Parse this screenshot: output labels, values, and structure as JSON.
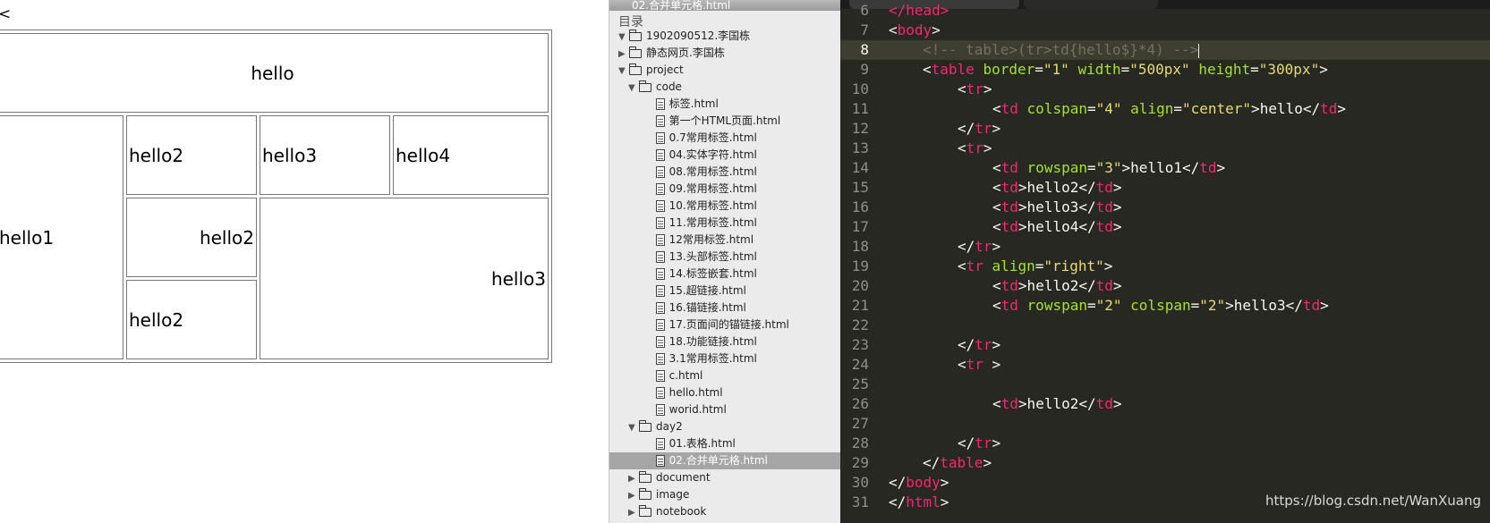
{
  "browser": {
    "stray_text": "<",
    "table": {
      "r1": "hello",
      "r2": [
        "hello1",
        "hello2",
        "hello3",
        "hello4"
      ],
      "r3": [
        "hello2",
        "hello3"
      ],
      "r4": [
        "hello2"
      ]
    }
  },
  "sidebar": {
    "top_file": "02.合并单元格.html",
    "heading": "目录",
    "items": [
      {
        "label": "1902090512.李国栋",
        "type": "folder",
        "expanded": true
      },
      {
        "label": "静态网页.李国栋",
        "type": "folder",
        "expanded": false
      },
      {
        "label": "project",
        "type": "folder",
        "expanded": true
      },
      {
        "label": "code",
        "type": "folder",
        "expanded": true
      },
      {
        "label": "标签.html",
        "type": "file"
      },
      {
        "label": "第一个HTML页面.html",
        "type": "file"
      },
      {
        "label": "0.7常用标签.html",
        "type": "file"
      },
      {
        "label": "04.实体字符.html",
        "type": "file"
      },
      {
        "label": "08.常用标签.html",
        "type": "file"
      },
      {
        "label": "09.常用标签.html",
        "type": "file"
      },
      {
        "label": "10.常用标签.html",
        "type": "file"
      },
      {
        "label": "11.常用标签.html",
        "type": "file"
      },
      {
        "label": "12常用标签.html",
        "type": "file"
      },
      {
        "label": "13.头部标签.html",
        "type": "file"
      },
      {
        "label": "14.标签嵌套.html",
        "type": "file"
      },
      {
        "label": "15.超链接.html",
        "type": "file"
      },
      {
        "label": "16.锚链接.html",
        "type": "file"
      },
      {
        "label": "17.页面间的锚链接.html",
        "type": "file"
      },
      {
        "label": "18.功能链接.html",
        "type": "file"
      },
      {
        "label": "3.1常用标签.html",
        "type": "file"
      },
      {
        "label": "c.html",
        "type": "file"
      },
      {
        "label": "hello.html",
        "type": "file"
      },
      {
        "label": "worid.html",
        "type": "file"
      },
      {
        "label": "day2",
        "type": "folder",
        "expanded": true
      },
      {
        "label": "01.表格.html",
        "type": "file"
      },
      {
        "label": "02.合并单元格.html",
        "type": "file",
        "selected": true
      },
      {
        "label": "document",
        "type": "folder",
        "expanded": false
      },
      {
        "label": "image",
        "type": "folder",
        "expanded": false
      },
      {
        "label": "notebook",
        "type": "folder",
        "expanded": false
      }
    ]
  },
  "editor": {
    "line_numbers": [
      "6",
      "7",
      "8",
      "9",
      "10",
      "11",
      "12",
      "13",
      "14",
      "15",
      "16",
      "17",
      "18",
      "19",
      "20",
      "21",
      "22",
      "23",
      "24",
      "25",
      "26",
      "27",
      "28",
      "29",
      "30",
      "31"
    ],
    "active_line": "8",
    "watermark": "https://blog.csdn.net/WanXuang",
    "code": {
      "l6": "</head>",
      "l7_tag": "body",
      "l8_comment": "<!-- table>(tr>td{hello$}*4) -->",
      "l9_tag": "table",
      "l9_a1": "border",
      "l9_v1": "\"1\"",
      "l9_a2": "width",
      "l9_v2": "\"500px\"",
      "l9_a3": "height",
      "l9_v3": "\"300px\"",
      "tr": "tr",
      "td": "td",
      "l11_a1": "colspan",
      "l11_v1": "\"4\"",
      "l11_a2": "align",
      "l11_v2": "\"center\"",
      "l11_text": "hello",
      "l14_a1": "rowspan",
      "l14_v1": "\"3\"",
      "l14_text": "hello1",
      "l15_text": "hello2",
      "l16_text": "hello3",
      "l17_text": "hello4",
      "l19_a1": "align",
      "l19_v1": "\"right\"",
      "l20_text": "hello2",
      "l21_a1": "rowspan",
      "l21_v1": "\"2\"",
      "l21_a2": "colspan",
      "l21_v2": "\"2\"",
      "l21_text": "hello3",
      "l26_text": "hello2",
      "l29_tag": "table",
      "l30_tag": "body",
      "l31_tag": "html"
    }
  }
}
